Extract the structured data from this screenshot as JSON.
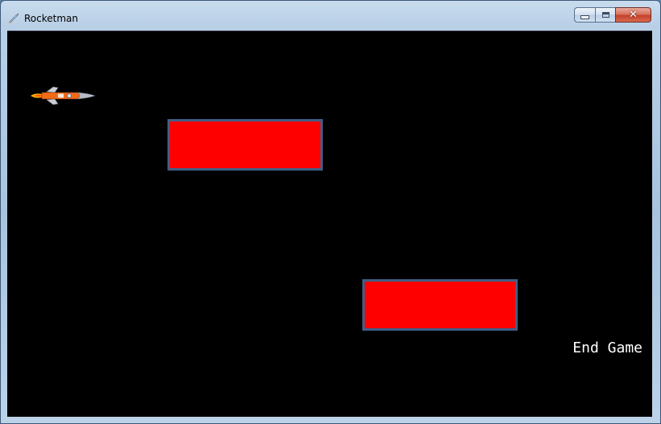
{
  "window": {
    "title": "Rocketman",
    "icon": "rocket-icon"
  },
  "caption_buttons": {
    "minimize_icon": "minimize-icon",
    "maximize_icon": "maximize-icon",
    "close_icon": "close-icon"
  },
  "game": {
    "background_color": "#000000",
    "player": "rocket",
    "obstacle_color": "#ff0000",
    "obstacle_border_color": "#3f5e86",
    "obstacle_count": 2,
    "end_game_label": "End Game"
  }
}
